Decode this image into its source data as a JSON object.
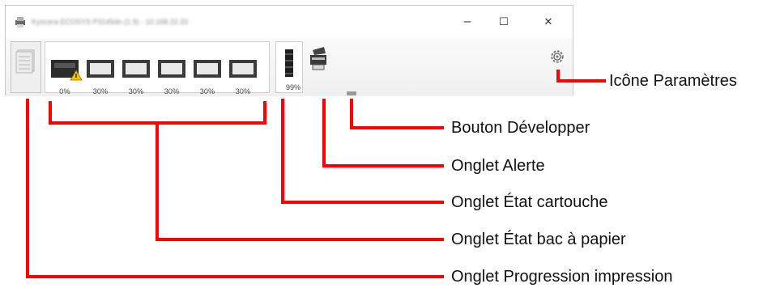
{
  "window": {
    "title": "Kyocera ECOSYS P3145dn (1.9) - 10.168.22.33",
    "minimize_label": "–",
    "maximize_label": "☐",
    "close_label": "✕",
    "title_bar_color": "#ffffff",
    "toolbar_color": "#f3f3f3"
  },
  "tabs": {
    "print_progress": {
      "icon": "document-stack-icon"
    },
    "paper_tray": {
      "trays": [
        {
          "icon": "tray-icon",
          "percent": "0%",
          "alert": true,
          "alert_icon": "warning-triangle-icon"
        },
        {
          "icon": "tray-icon",
          "percent": "30%"
        },
        {
          "icon": "tray-icon",
          "percent": "30%"
        },
        {
          "icon": "tray-icon",
          "percent": "30%"
        },
        {
          "icon": "tray-icon",
          "percent": "30%"
        },
        {
          "icon": "tray-icon",
          "percent": "30%"
        }
      ]
    },
    "toner": {
      "icon": "toner-cartridge-icon",
      "percent": "99%"
    },
    "alert": {
      "icon": "printer-alert-icon"
    },
    "expand": {
      "icon": "expand-bar-icon"
    },
    "settings": {
      "icon": "gear-icon"
    }
  },
  "callouts": {
    "settings_icon": "Icône Paramètres",
    "expand_button": "Bouton Développer",
    "alert_tab": "Onglet Alerte",
    "toner_tab": "Onglet État cartouche",
    "paper_tray_tab": "Onglet État bac à papier",
    "print_progress_tab": "Onglet Progression impression"
  },
  "colors": {
    "leader_line": "#ff0000",
    "warning": "#f5c400",
    "tray_dark": "#2b2b2b"
  }
}
